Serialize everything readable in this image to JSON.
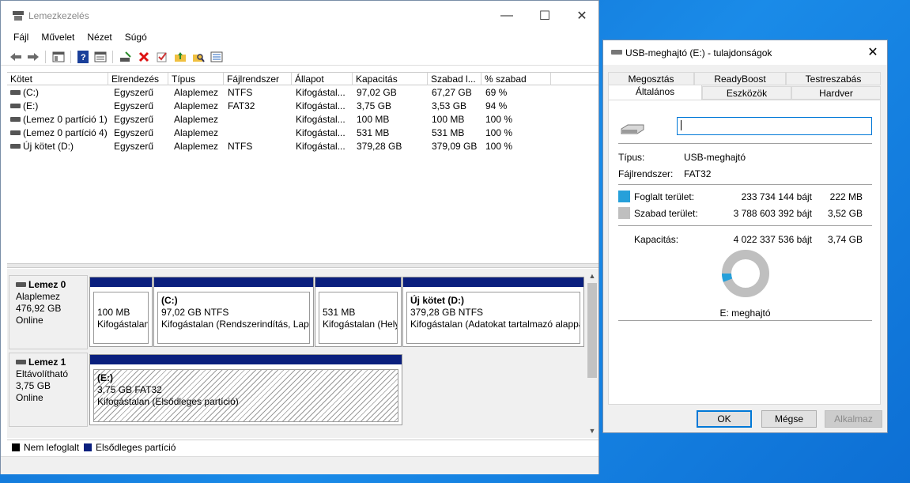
{
  "disk_mgmt": {
    "title": "Lemezkezelés",
    "menu": [
      "Fájl",
      "Művelet",
      "Nézet",
      "Súgó"
    ],
    "columns": [
      "Kötet",
      "Elrendezés",
      "Típus",
      "Fájlrendszer",
      "Állapot",
      "Kapacitás",
      "Szabad l...",
      "% szabad"
    ],
    "rows": [
      [
        "(C:)",
        "Egyszerű",
        "Alaplemez",
        "NTFS",
        "Kifogástal...",
        "97,02 GB",
        "67,27 GB",
        "69 %"
      ],
      [
        "(E:)",
        "Egyszerű",
        "Alaplemez",
        "FAT32",
        "Kifogástal...",
        "3,75 GB",
        "3,53 GB",
        "94 %"
      ],
      [
        "(Lemez 0 partíció 1)",
        "Egyszerű",
        "Alaplemez",
        "",
        "Kifogástal...",
        "100 MB",
        "100 MB",
        "100 %"
      ],
      [
        "(Lemez 0 partíció 4)",
        "Egyszerű",
        "Alaplemez",
        "",
        "Kifogástal...",
        "531 MB",
        "531 MB",
        "100 %"
      ],
      [
        "Új kötet (D:)",
        "Egyszerű",
        "Alaplemez",
        "NTFS",
        "Kifogástal...",
        "379,28 GB",
        "379,09 GB",
        "100 %"
      ]
    ],
    "disks": [
      {
        "name": "Lemez 0",
        "type": "Alaplemez",
        "size": "476,92 GB",
        "status": "Online",
        "partitions": [
          {
            "name": "",
            "size": "100 MB",
            "status": "Kifogástalan"
          },
          {
            "name": "(C:)",
            "size": "97,02 GB NTFS",
            "status": "Kifogástalan (Rendszerindítás, Lapo"
          },
          {
            "name": "",
            "size": "531 MB",
            "status": "Kifogástalan (Hely"
          },
          {
            "name": "Új kötet  (D:)",
            "size": "379,28 GB NTFS",
            "status": "Kifogástalan (Adatokat tartalmazó alappa"
          }
        ]
      },
      {
        "name": "Lemez 1",
        "type": "Eltávolítható",
        "size": "3,75 GB",
        "status": "Online",
        "partitions": [
          {
            "name": "(E:)",
            "size": "3,75 GB FAT32",
            "status": "Kifogástalan (Elsődleges partíció)"
          }
        ]
      }
    ],
    "legend": {
      "unallocated": "Nem lefoglalt",
      "primary": "Elsődleges partíció"
    }
  },
  "properties": {
    "title": "USB-meghajtó (E:) - tulajdonságok",
    "tabs_top": [
      "Megosztás",
      "ReadyBoost",
      "Testreszabás"
    ],
    "tabs_bottom": [
      "Általános",
      "Eszközök",
      "Hardver"
    ],
    "name_value": "",
    "type_label": "Típus:",
    "type_value": "USB-meghajtó",
    "fs_label": "Fájlrendszer:",
    "fs_value": "FAT32",
    "used_label": "Foglalt terület:",
    "used_bytes": "233 734 144 bájt",
    "used_short": "222 MB",
    "free_label": "Szabad terület:",
    "free_bytes": "3 788 603 392 bájt",
    "free_short": "3,52 GB",
    "cap_label": "Kapacitás:",
    "cap_bytes": "4 022 337 536 bájt",
    "cap_short": "3,74 GB",
    "drive_label": "E: meghajtó",
    "used_fraction": 0.058,
    "buttons": {
      "ok": "OK",
      "cancel": "Mégse",
      "apply": "Alkalmaz"
    },
    "colors": {
      "used": "#26a0da",
      "free": "#bfbfbf"
    }
  }
}
